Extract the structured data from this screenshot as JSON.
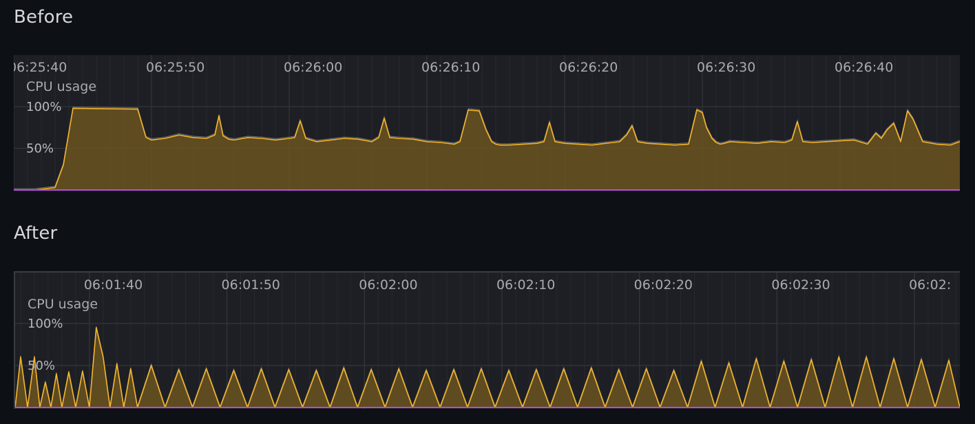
{
  "sections": {
    "before": {
      "title": "Before"
    },
    "after": {
      "title": "After"
    }
  },
  "colors": {
    "background": "#0d1015",
    "panel": "#1d1f24",
    "grid": "#33363c",
    "cpu_line": "#f4b52a",
    "cpu_fill": "#6b5420",
    "gray_line": "#8a8d92",
    "baseline": "#b04fd6"
  },
  "chart_data": [
    {
      "type": "area",
      "section": "Before",
      "ylabel": "CPU usage",
      "y_ticks": [
        "100%",
        "50%"
      ],
      "ylim": [
        0,
        100
      ],
      "x_tick_labels": [
        "06:25:40",
        "06:25:50",
        "06:26:00",
        "06:26:10",
        "06:26:20",
        "06:26:30",
        "06:26:40"
      ],
      "x_tick_seconds": [
        0,
        10,
        20,
        30,
        40,
        50,
        60
      ],
      "xlim": [
        0,
        68.7
      ],
      "grid": true,
      "series": [
        {
          "x": [
            0,
            0.8,
            1.5,
            3.0,
            3.6,
            4.3,
            9.0,
            9.3,
            9.6,
            10.0,
            11.0,
            12.0,
            13.0,
            14.0,
            14.6,
            14.9,
            15.2,
            15.6,
            16.0,
            17.0,
            18.0,
            19.0,
            20.0,
            20.4,
            20.8,
            21.2,
            22.0,
            23.0,
            24.0,
            25.0,
            26.0,
            26.5,
            26.9,
            27.3,
            28.0,
            29.0,
            30.0,
            31.0,
            32.0,
            32.4,
            33.0,
            33.8,
            34.3,
            34.7,
            35.0,
            35.3,
            36.0,
            37.0,
            38.0,
            38.5,
            38.9,
            39.3,
            40.0,
            41.0,
            42.0,
            43.0,
            44.0,
            44.5,
            44.9,
            45.3,
            46.0,
            47.0,
            48.0,
            49.0,
            49.6,
            50.0,
            50.3,
            50.7,
            51.0,
            51.3,
            51.6,
            52.0,
            53.0,
            54.0,
            55.0,
            56.0,
            56.5,
            56.9,
            57.3,
            58.0,
            59.0,
            60.0,
            61.0,
            62.0,
            62.6,
            63.0,
            63.4,
            63.9,
            64.4,
            64.9,
            65.3,
            66.0,
            67.0,
            68.0,
            68.7
          ],
          "y": [
            0,
            0,
            0,
            3,
            30,
            98,
            97,
            80,
            63,
            60,
            62,
            66,
            63,
            62,
            66,
            89,
            65,
            61,
            60,
            63,
            62,
            60,
            62,
            63,
            83,
            62,
            58,
            60,
            62,
            61,
            58,
            63,
            86,
            63,
            62,
            61,
            58,
            57,
            55,
            58,
            96,
            95,
            72,
            58,
            55,
            54,
            54,
            55,
            56,
            58,
            81,
            58,
            56,
            55,
            54,
            56,
            58,
            66,
            77,
            58,
            56,
            55,
            54,
            55,
            96,
            93,
            75,
            62,
            57,
            55,
            56,
            58,
            57,
            56,
            58,
            57,
            60,
            82,
            58,
            57,
            58,
            59,
            60,
            55,
            68,
            62,
            72,
            80,
            58,
            95,
            85,
            58,
            55,
            54,
            58
          ]
        }
      ]
    },
    {
      "type": "area",
      "section": "After",
      "ylabel": "CPU usage",
      "y_ticks": [
        "100%",
        "50%"
      ],
      "ylim": [
        0,
        100
      ],
      "x_tick_labels": [
        "06:01:40",
        "06:01:50",
        "06:02:00",
        "06:02:10",
        "06:02:20",
        "06:02:30",
        "06:02:"
      ],
      "x_tick_seconds": [
        0,
        10,
        20,
        30,
        40,
        50,
        60
      ],
      "xlim": [
        -5.4,
        63.3
      ],
      "grid": true,
      "series": [
        {
          "x": [
            -5.4,
            -5.0,
            -4.5,
            -4.0,
            -3.6,
            -3.2,
            -2.8,
            -2.4,
            -2.0,
            -1.5,
            -1.0,
            -0.5,
            0.0,
            0.5,
            1.0,
            1.5,
            2.0,
            2.5,
            3.0,
            3.5,
            4.5,
            5.5,
            6.5,
            7.5,
            8.5,
            9.5,
            10.5,
            11.5,
            12.5,
            13.5,
            14.5,
            15.5,
            16.5,
            17.5,
            18.5,
            19.5,
            20.5,
            21.5,
            22.5,
            23.5,
            24.5,
            25.5,
            26.5,
            27.5,
            28.5,
            29.5,
            30.5,
            31.5,
            32.5,
            33.5,
            34.5,
            35.5,
            36.5,
            37.5,
            38.5,
            39.5,
            40.5,
            41.5,
            42.5,
            43.5,
            44.5,
            45.5,
            46.5,
            47.5,
            48.5,
            49.5,
            50.5,
            51.5,
            52.5,
            53.5,
            54.5,
            55.5,
            56.5,
            57.5,
            58.5,
            59.5,
            60.5,
            61.5,
            62.5,
            63.3
          ],
          "y": [
            0,
            60,
            0,
            60,
            0,
            30,
            0,
            40,
            0,
            42,
            0,
            43,
            0,
            95,
            60,
            0,
            52,
            0,
            46,
            0,
            50,
            0,
            45,
            0,
            46,
            0,
            44,
            0,
            46,
            0,
            45,
            0,
            44,
            0,
            47,
            0,
            45,
            0,
            46,
            0,
            44,
            0,
            45,
            0,
            46,
            0,
            44,
            0,
            45,
            0,
            46,
            0,
            47,
            0,
            45,
            0,
            46,
            0,
            44,
            0,
            55,
            0,
            53,
            0,
            58,
            0,
            55,
            0,
            57,
            0,
            60,
            0,
            60,
            0,
            58,
            0,
            57,
            0,
            56,
            0
          ]
        }
      ]
    }
  ]
}
